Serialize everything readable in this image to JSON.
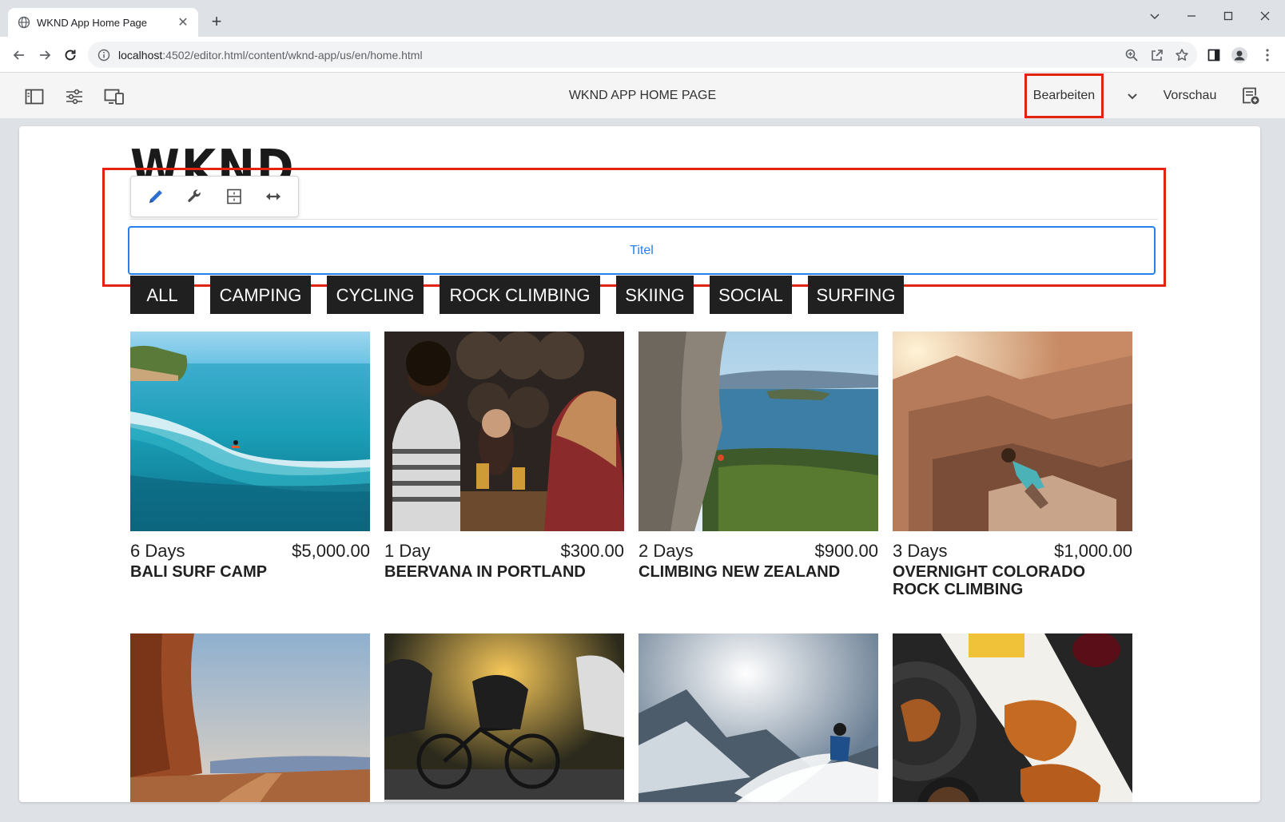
{
  "browser": {
    "tab_title": "WKND App Home Page",
    "url_host": "localhost",
    "url_path": ":4502/editor.html/content/wknd-app/us/en/home.html"
  },
  "editor": {
    "page_title": "WKND APP HOME PAGE",
    "edit_label": "Bearbeiten",
    "preview_label": "Vorschau",
    "highlight_color": "#e3220f",
    "accent_color": "#2680eb"
  },
  "page": {
    "logo": "WKND",
    "title_placeholder": "Titel",
    "filters": [
      "ALL",
      "CAMPING",
      "CYCLING",
      "ROCK CLIMBING",
      "SKIING",
      "SOCIAL",
      "SURFING"
    ],
    "adventures": [
      {
        "duration": "6 Days",
        "price": "$5,000.00",
        "name": "BALI SURF CAMP"
      },
      {
        "duration": "1 Day",
        "price": "$300.00",
        "name": "BEERVANA IN PORTLAND"
      },
      {
        "duration": "2 Days",
        "price": "$900.00",
        "name": "CLIMBING NEW ZEALAND"
      },
      {
        "duration": "3 Days",
        "price": "$1,000.00",
        "name": "OVERNIGHT COLORADO ROCK CLIMBING"
      }
    ]
  }
}
